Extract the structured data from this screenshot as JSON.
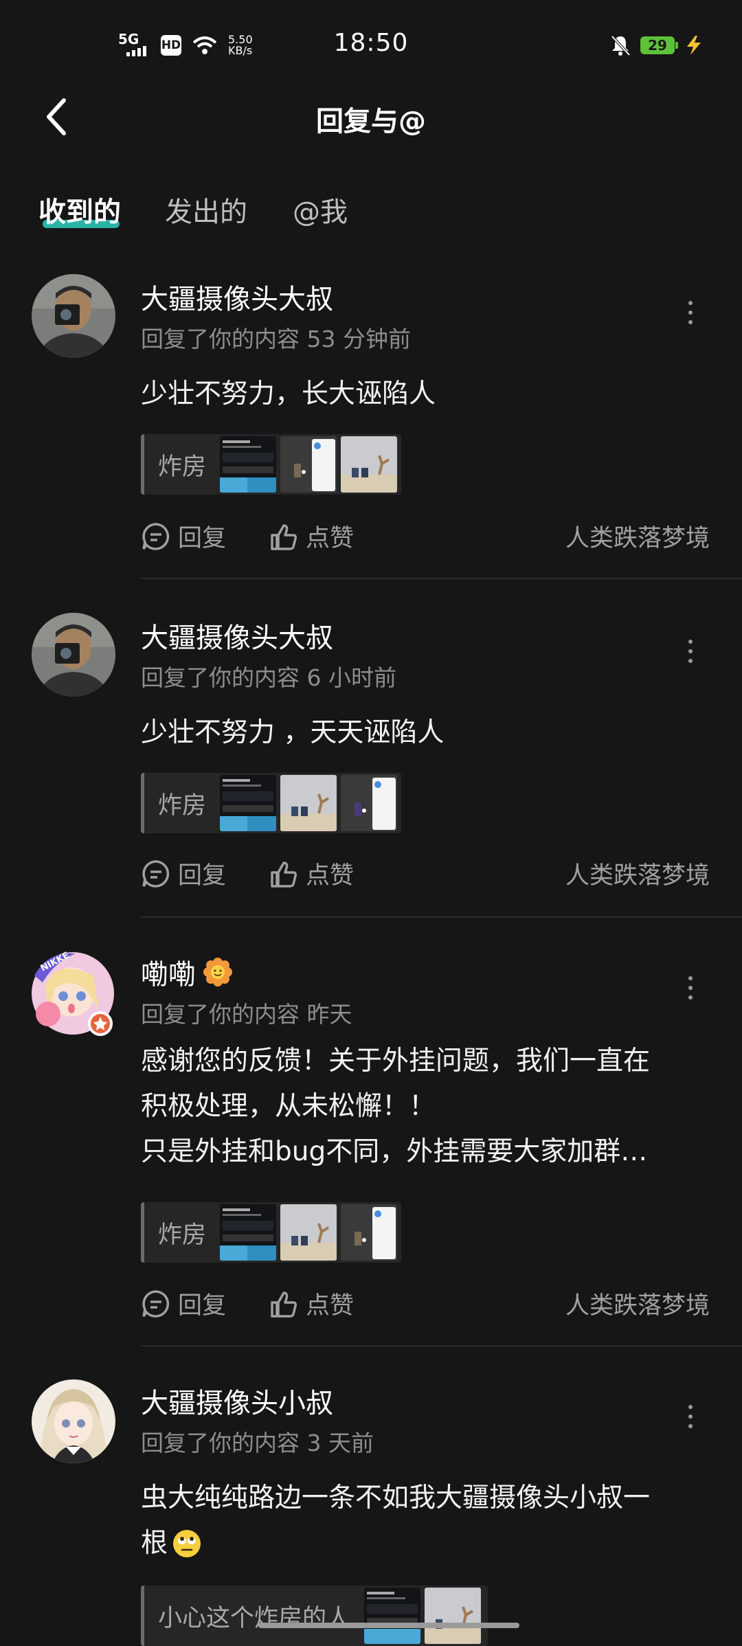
{
  "status_bar": {
    "signal": "5G",
    "hd": "HD",
    "speed_value": "5.50",
    "speed_unit": "KB/s",
    "time": "18:50",
    "battery": "29"
  },
  "header": {
    "title": "回复与@"
  },
  "tabs": [
    {
      "label": "收到的",
      "active": true
    },
    {
      "label": "发出的",
      "active": false
    },
    {
      "label": "@我",
      "active": false
    }
  ],
  "items": [
    {
      "name": "大疆摄像头大叔",
      "meta": "回复了你的内容 53 分钟前",
      "text": [
        "少壮不努力，长大诬陷人"
      ],
      "ref_label": "炸房",
      "actions": {
        "reply": "回复",
        "like": "点赞",
        "source": "人类跌落梦境"
      }
    },
    {
      "name": "大疆摄像头大叔",
      "meta": "回复了你的内容 6 小时前",
      "text": [
        "少壮不努力 ，天天诬陷人"
      ],
      "ref_label": "炸房",
      "actions": {
        "reply": "回复",
        "like": "点赞",
        "source": "人类跌落梦境"
      }
    },
    {
      "name": "嘞嘞",
      "meta": "回复了你的内容 昨天",
      "text": [
        "感谢您的反馈！关于外挂问题，我们一直在",
        "积极处理，从未松懈！！",
        "只是外挂和bug不同，外挂需要大家加群…"
      ],
      "ref_label": "炸房",
      "actions": {
        "reply": "回复",
        "like": "点赞",
        "source": "人类跌落梦境"
      }
    },
    {
      "name": "大疆摄像头小叔",
      "meta": "回复了你的内容 3 天前",
      "text": [
        "虫大纯纯路边一条不如我大疆摄像头小叔一",
        "根"
      ],
      "ref_label": "小心这个炸房的人"
    }
  ],
  "colors": {
    "background": "#161616",
    "accent_underline": "#2ab3a7",
    "muted": "#8d8d8d"
  },
  "icons": [
    "back-arrow-icon",
    "more-icon",
    "reply-icon",
    "like-icon",
    "flower-emoji-icon",
    "eye-roll-emoji-icon",
    "bell-mute-icon",
    "wifi-icon",
    "charging-icon"
  ]
}
